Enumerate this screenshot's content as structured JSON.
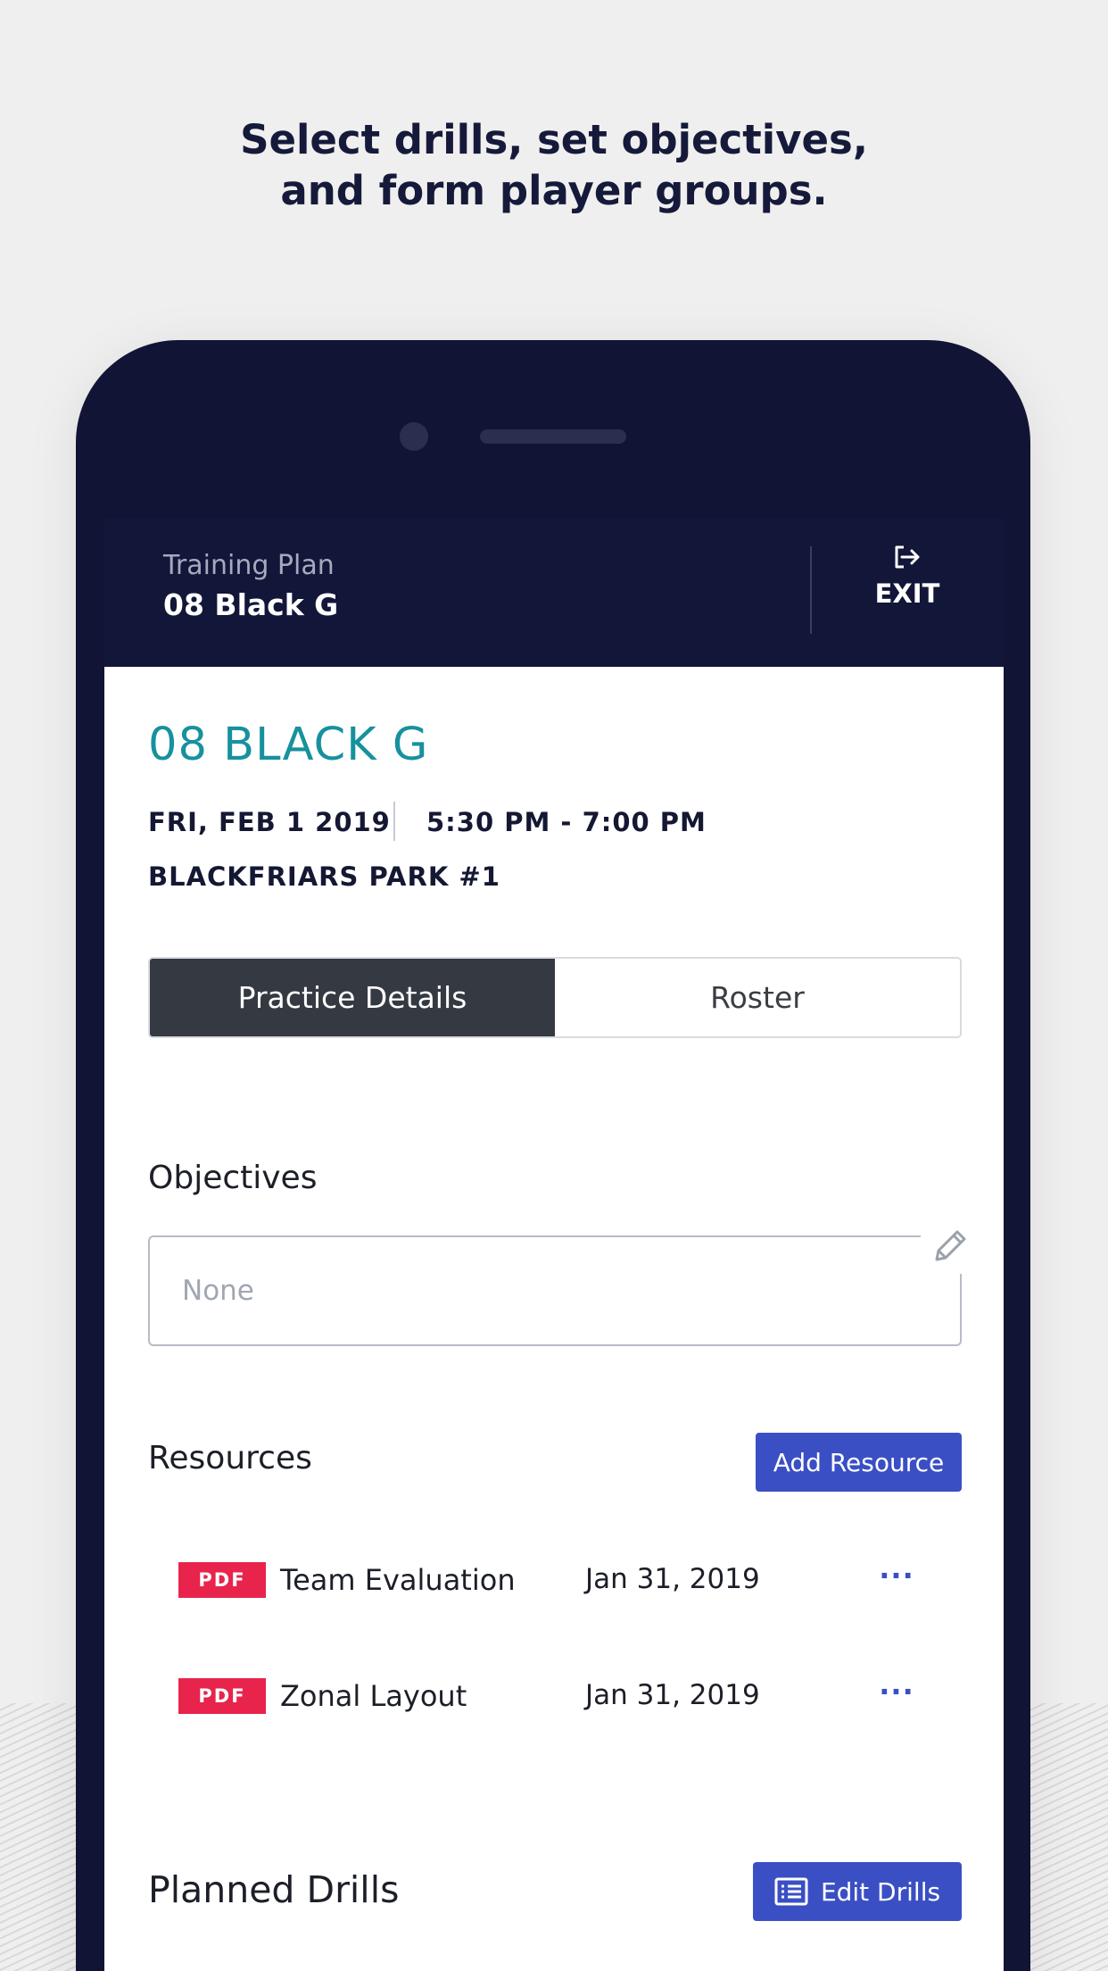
{
  "headline": {
    "line1": "Select drills, set objectives,",
    "line2": "and form player groups."
  },
  "app_bar": {
    "subtitle": "Training Plan",
    "title": "08 Black G",
    "exit_label": "EXIT",
    "exit_icon": "exit-icon"
  },
  "practice": {
    "team_name": "08 BLACK G",
    "date": "FRI, FEB 1 2019",
    "time": "5:30 PM - 7:00 PM",
    "venue": "BLACKFRIARS PARK #1"
  },
  "tabs": [
    {
      "label": "Practice Details",
      "active": true
    },
    {
      "label": "Roster",
      "active": false
    }
  ],
  "objectives": {
    "title": "Objectives",
    "value": "None",
    "edit_icon": "pencil-icon"
  },
  "resources": {
    "title": "Resources",
    "add_label": "Add Resource",
    "items": [
      {
        "type": "PDF",
        "name": "Team Evaluation",
        "date": "Jan 31, 2019",
        "more": "···"
      },
      {
        "type": "PDF",
        "name": "Zonal Layout",
        "date": "Jan 31, 2019",
        "more": "···"
      }
    ]
  },
  "planned_drills": {
    "title": "Planned Drills",
    "edit_label": "Edit Drills",
    "edit_icon": "list-icon"
  },
  "colors": {
    "phone": "#111435",
    "accent_teal": "#17919d",
    "button_blue": "#3a4fc4",
    "pdf_red": "#e8244d",
    "active_tab": "#353a42"
  }
}
